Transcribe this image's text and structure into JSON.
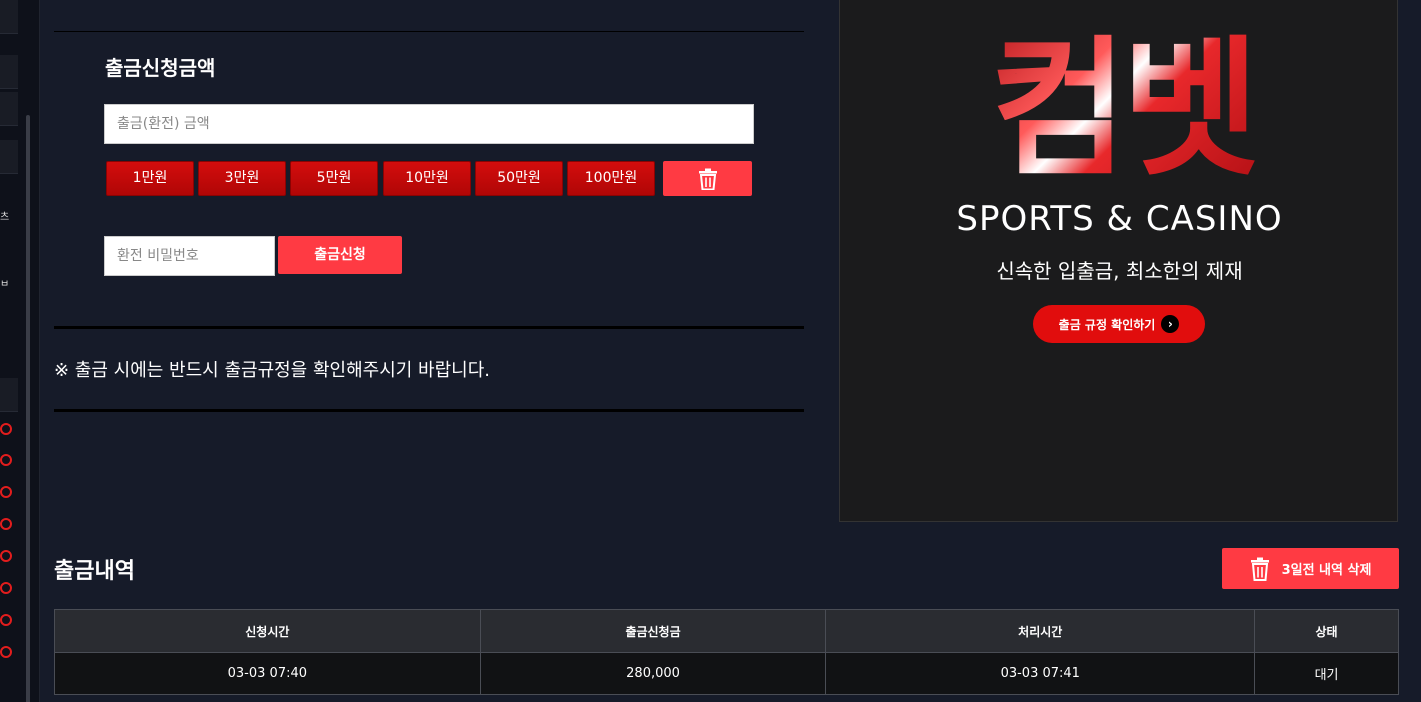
{
  "sidebar": {
    "partial_labels": [
      "츠",
      "ㅂ"
    ]
  },
  "form": {
    "title": "출금신청금액",
    "amount_placeholder": "출금(환전) 금액",
    "quick_amounts": [
      "1만원",
      "3만원",
      "5만원",
      "10만원",
      "50만원",
      "100만원"
    ],
    "password_placeholder": "환전 비밀번호",
    "submit_label": "출금신청"
  },
  "notice": "※ 출금 시에는 반드시 출금규정을 확인해주시기 바랍니다.",
  "promo": {
    "logo": "컴벳",
    "subtitle": "SPORTS & CASINO",
    "tagline": "신속한 입출금, 최소한의 제재",
    "rules_button": "출금 규정 확인하기"
  },
  "history": {
    "title": "출금내역",
    "delete_button": "3일전 내역 삭제",
    "columns": [
      "신청시간",
      "출금신청금",
      "처리시간",
      "상태"
    ],
    "rows": [
      [
        "03-03 07:40",
        "280,000",
        "03-03 07:41",
        "대기"
      ]
    ]
  },
  "colors": {
    "background": "#161b29",
    "accent_red": "#ff3a43",
    "quick_button_red": "#c80a0a"
  }
}
